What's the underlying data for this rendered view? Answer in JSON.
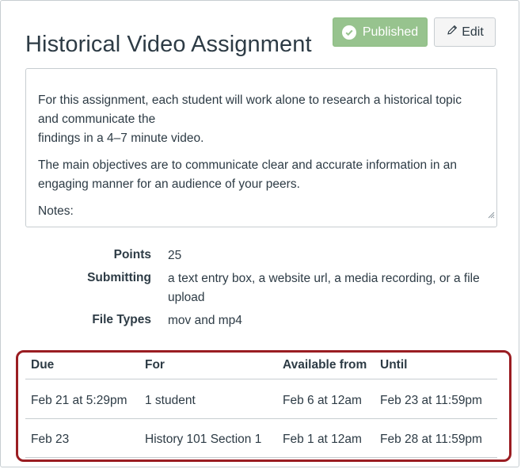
{
  "assignment": {
    "title": "Historical Video Assignment",
    "published_label": "Published",
    "edit_label": "Edit"
  },
  "description": {
    "paragraphs": [
      "For this assignment, each student will work alone to research a historical topic and communicate the",
      "findings in a 4–7 minute video.",
      "The main objectives are to communicate clear and accurate information in an engaging manner for an audience of your peers.",
      "Notes:"
    ]
  },
  "details": {
    "points_label": "Points",
    "points_value": "25",
    "submitting_label": "Submitting",
    "submitting_value": "a text entry box, a website url, a media recording, or a file upload",
    "file_types_label": "File Types",
    "file_types_value": "mov and mp4"
  },
  "dates_table": {
    "headers": [
      "Due",
      "For",
      "Available from",
      "Until"
    ],
    "rows": [
      [
        "Feb 21 at 5:29pm",
        "1 student",
        "Feb 6 at 12am",
        "Feb 23 at 11:59pm"
      ],
      [
        "Feb 23",
        "History 101 Section 1",
        "Feb 1 at 12am",
        "Feb 28 at 11:59pm"
      ]
    ]
  },
  "icons": {
    "published": "check-circle-icon",
    "edit": "pencil-icon",
    "resize": "resize-grip-icon"
  },
  "colors": {
    "published_bg": "#97c38e",
    "highlight_border": "#9a1d22",
    "text": "#2d3b45"
  }
}
